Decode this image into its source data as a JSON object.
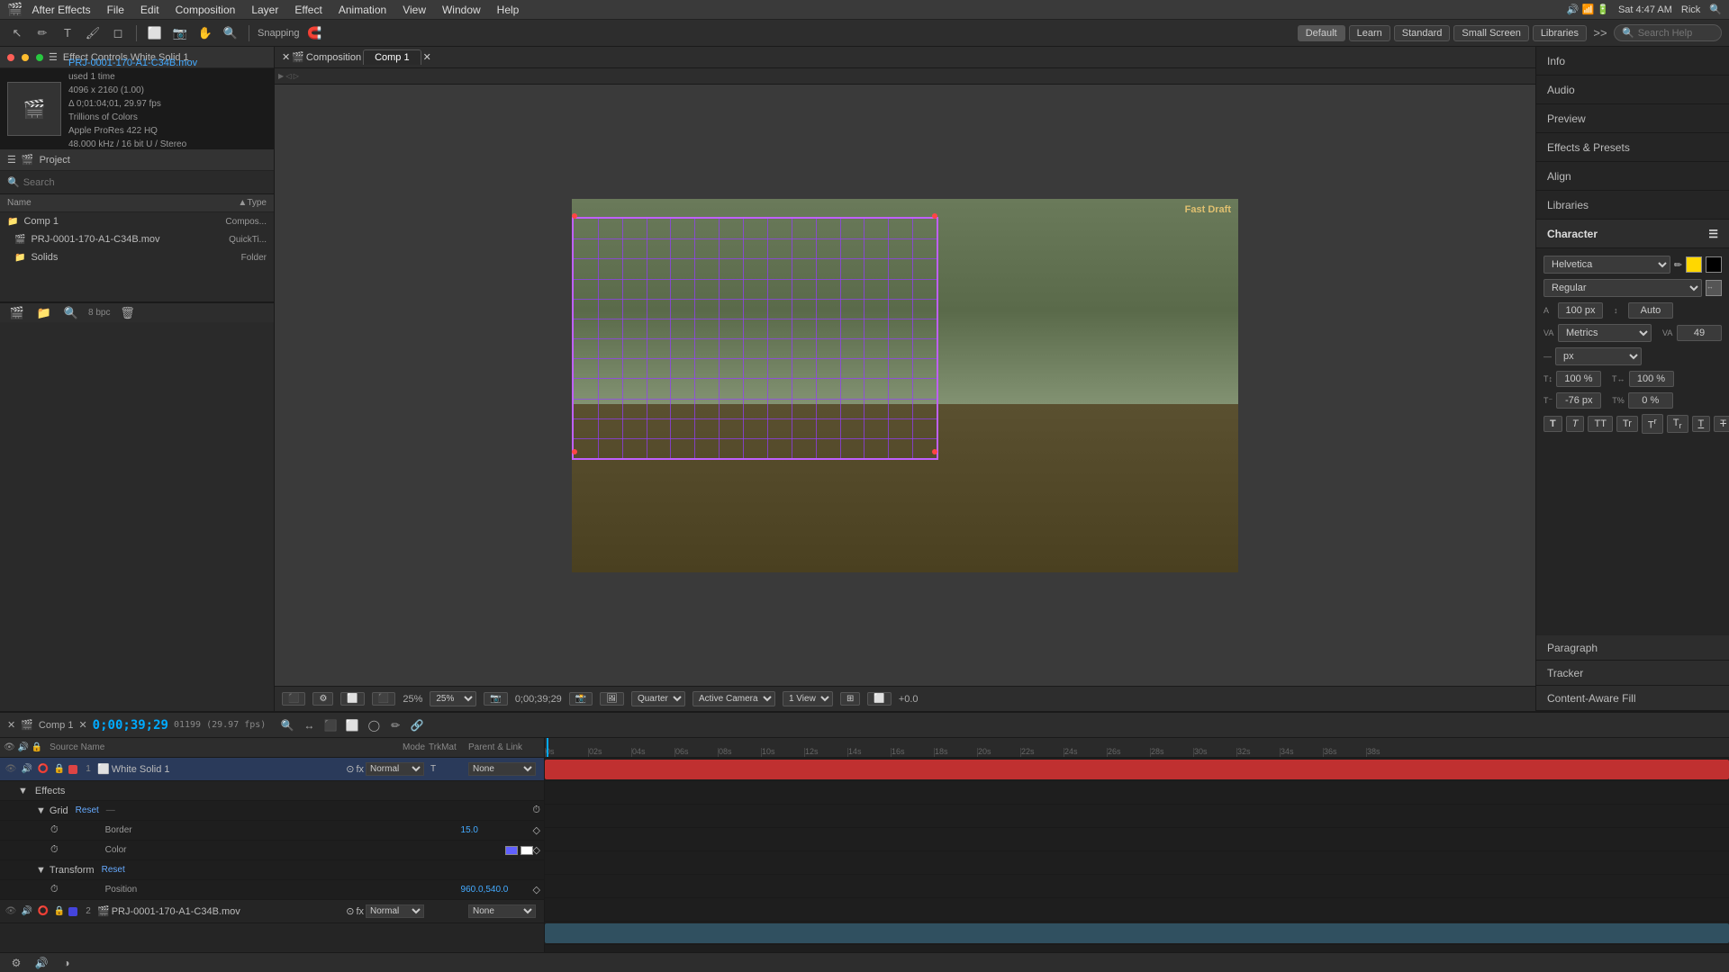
{
  "app": {
    "name": "After Effects",
    "time": "Sat 4:47 AM",
    "user": "Rick"
  },
  "menubar": {
    "items": [
      "After Effects",
      "File",
      "Edit",
      "Composition",
      "Layer",
      "Effect",
      "Animation",
      "View",
      "Window",
      "Help"
    ]
  },
  "toolbar": {
    "snapping_label": "Snapping",
    "workspaces": [
      "Default",
      "Learn",
      "Standard",
      "Small Screen",
      "Libraries"
    ],
    "search_placeholder": "Search Help"
  },
  "project_panel": {
    "title": "Project",
    "effect_controls_title": "Effect Controls White Solid 1"
  },
  "source": {
    "filename": "PRJ-0001-170-A1-C34B.mov",
    "used": "used 1 time",
    "resolution": "4096 x 2160 (1.00)",
    "duration": "Δ 0;01:04;01, 29.97 fps",
    "color": "Trillions of Colors",
    "codec": "Apple ProRes 422 HQ",
    "audio": "48.000 kHz / 16 bit U / Stereo"
  },
  "project_table": {
    "headers": [
      "Name",
      "Type"
    ],
    "rows": [
      {
        "name": "Comp 1",
        "type": "Compos...",
        "icon": "📁",
        "color": "green"
      },
      {
        "name": "PRJ-0001-170-A1-C34B.mov",
        "type": "QuickTi...",
        "icon": "🎬",
        "color": "blue",
        "indent": true
      },
      {
        "name": "Solids",
        "type": "Folder",
        "icon": "📁",
        "color": "orange",
        "indent": true
      }
    ]
  },
  "viewport": {
    "comp_tab": "Comp 1",
    "timecode": "0;00;39;29",
    "quality": "Fast Draft",
    "zoom": "25%",
    "resolution": "Quarter",
    "view": "Active Camera",
    "layout": "1 View",
    "offset": "+0.0"
  },
  "right_panel": {
    "sections": [
      "Info",
      "Audio",
      "Preview",
      "Effects & Presets",
      "Align",
      "Libraries"
    ],
    "character": {
      "title": "Character",
      "font_family": "Helvetica",
      "font_style": "Regular",
      "font_size": "100 px",
      "font_size_auto": "Auto",
      "kerning": "Metrics",
      "tracking": "49",
      "leading": "- px",
      "vertical_scale": "100 %",
      "horizontal_scale": "100 %",
      "baseline_shift": "-76 px",
      "tsukuri": "0 %"
    },
    "other_sections": [
      "Paragraph",
      "Tracker",
      "Content-Aware Fill"
    ]
  },
  "timeline": {
    "comp_name": "Comp 1",
    "timecode": "0;00;39;29",
    "fps_note": "01199 (29.97 fps)",
    "ruler_marks": [
      "0s",
      "02s",
      "04s",
      "06s",
      "08s",
      "10s",
      "12s",
      "14s",
      "16s",
      "18s",
      "20s",
      "22s",
      "24s",
      "26s",
      "28s",
      "30s",
      "32s",
      "34s",
      "36s",
      "38s"
    ],
    "layers": [
      {
        "num": "1",
        "name": "White Solid 1",
        "color": "red",
        "mode": "Normal",
        "parent": "None",
        "visible": true,
        "has_effects": true,
        "effects": [
          {
            "name": "Effects",
            "children": [
              {
                "name": "Grid",
                "reset": "Reset",
                "children": [
                  {
                    "name": "Border",
                    "value": "15.0"
                  },
                  {
                    "name": "Color",
                    "value": ""
                  }
                ]
              }
            ]
          }
        ],
        "transform": {
          "name": "Transform",
          "reset": "Reset",
          "properties": [
            {
              "name": "Position",
              "value": "960.0,540.0"
            }
          ]
        }
      },
      {
        "num": "2",
        "name": "PRJ-0001-170-A1-C34B.mov",
        "color": "blue",
        "mode": "Normal",
        "parent": "None",
        "visible": true
      }
    ]
  },
  "status_bar": {
    "bpc": "8 bpc"
  }
}
